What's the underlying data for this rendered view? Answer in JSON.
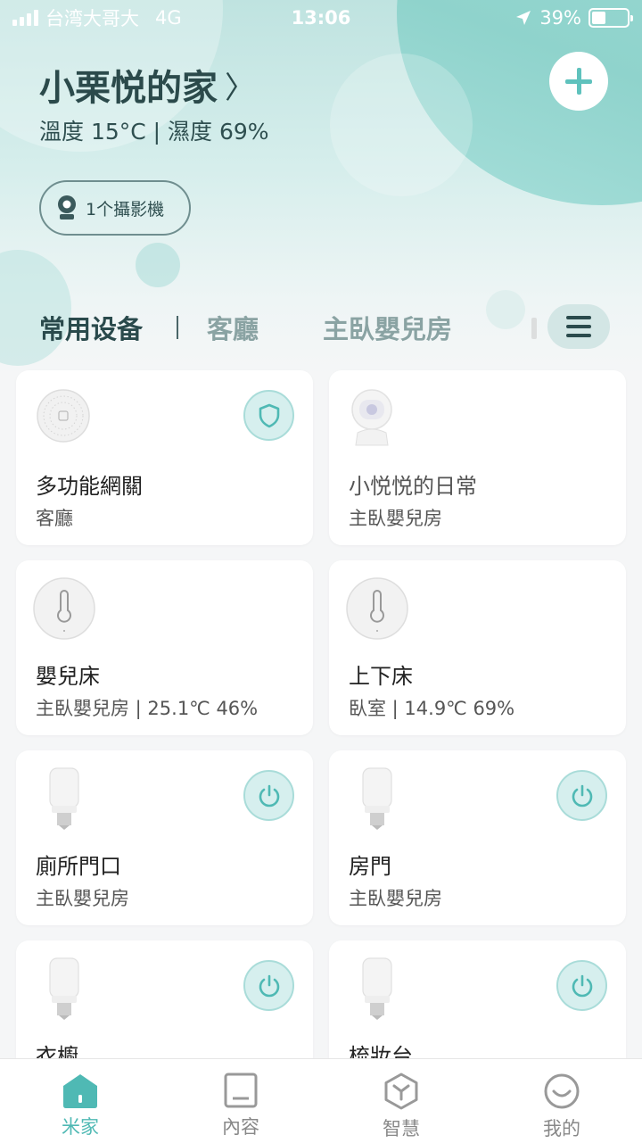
{
  "status_bar": {
    "carrier": "台湾大哥大",
    "network": "4G",
    "time": "13:06",
    "battery": "39%",
    "battery_level": 0.39
  },
  "header": {
    "home_name": "小栗悦的家",
    "weather": "溫度 15°C | 濕度 69%",
    "camera_chip": "1个攝影機"
  },
  "tabs": [
    {
      "label": "常用设备",
      "active": true
    },
    {
      "label": "客廳",
      "active": false
    },
    {
      "label": "主臥嬰兒房",
      "active": false
    }
  ],
  "devices": [
    {
      "name": "多功能網關",
      "room": "客廳",
      "icon": "gateway-icon",
      "action": "shield-icon"
    },
    {
      "name": "小悦悦的日常",
      "room": "主臥嬰兒房",
      "icon": "camera-icon",
      "action": ""
    },
    {
      "name": "嬰兒床",
      "room": "主臥嬰兒房 | 25.1℃ 46%",
      "icon": "thermometer-icon",
      "action": ""
    },
    {
      "name": "上下床",
      "room": "臥室 | 14.9℃ 69%",
      "icon": "thermometer-icon",
      "action": ""
    },
    {
      "name": "廁所門口",
      "room": "主臥嬰兒房",
      "icon": "bulb-icon",
      "action": "power-icon"
    },
    {
      "name": "房門",
      "room": "主臥嬰兒房",
      "icon": "bulb-icon",
      "action": "power-icon"
    },
    {
      "name": "衣櫥",
      "room": "",
      "icon": "bulb-icon",
      "action": "power-icon"
    },
    {
      "name": "梳妝台",
      "room": "",
      "icon": "bulb-icon",
      "action": "power-icon"
    }
  ],
  "bottom_nav": [
    {
      "label": "米家",
      "icon": "home-icon",
      "active": true
    },
    {
      "label": "內容",
      "icon": "content-icon",
      "active": false
    },
    {
      "label": "智慧",
      "icon": "smart-icon",
      "active": false
    },
    {
      "label": "我的",
      "icon": "profile-icon",
      "active": false
    }
  ],
  "colors": {
    "accent": "#4fb9b4",
    "title": "#2b4a4b",
    "toggle_bg": "#d6efee"
  }
}
